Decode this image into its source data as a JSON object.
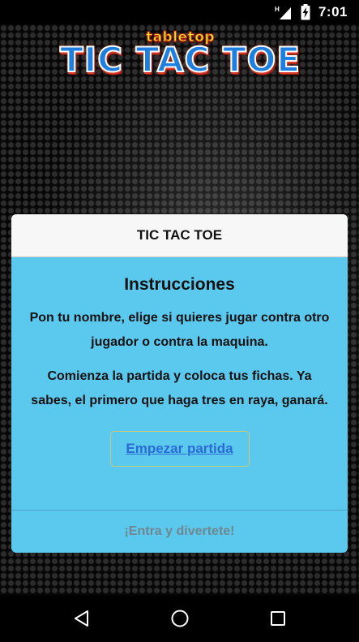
{
  "status_bar": {
    "time": "7:01",
    "network_label": "H",
    "icons": [
      "signal-icon",
      "battery-charging-icon"
    ]
  },
  "logo": {
    "top_text": "tabletop",
    "main_text": "TIC TAC TOE"
  },
  "dialog": {
    "title": "TIC TAC TOE",
    "heading": "Instrucciones",
    "paragraph1": "Pon tu nombre, elige si quieres jugar contra otro jugador o contra la maquina.",
    "paragraph2": "Comienza la partida y coloca tus fichas. Ya sabes, el primero que haga tres en raya, ganará.",
    "start_button": "Empezar partida",
    "footer": "¡Entra y divertete!"
  },
  "nav_bar": {
    "icons": [
      "back-icon",
      "home-icon",
      "recents-icon"
    ]
  },
  "colors": {
    "dialog_body": "#5bc8ee",
    "dialog_header": "#f7f7f7",
    "link": "#2a6ad8",
    "footer_text": "#6f8791"
  }
}
